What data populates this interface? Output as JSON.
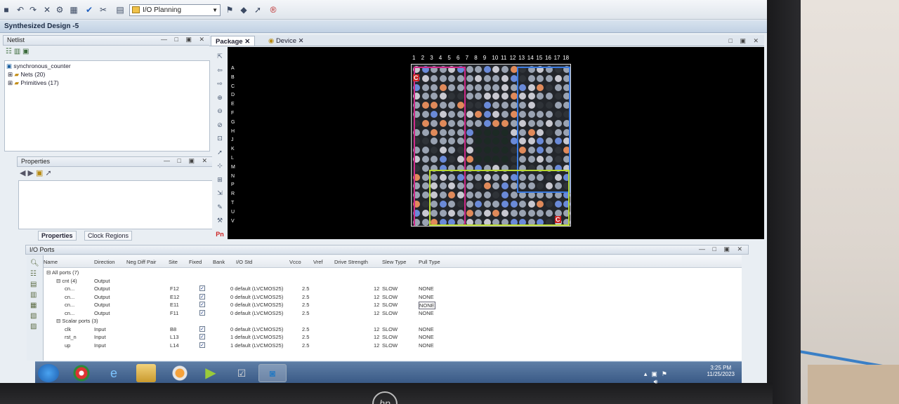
{
  "toolbar": {
    "layout_value": "I/O Planning"
  },
  "design_bar": {
    "title": "Synthesized Design -5"
  },
  "netlist": {
    "title": "Netlist",
    "root": "synchronous_counter",
    "nets": "Nets (20)",
    "primitives": "Primitives (17)"
  },
  "properties": {
    "title": "Properties",
    "tab_properties": "Properties",
    "tab_clock_regions": "Clock Regions"
  },
  "package_view": {
    "tab_package": "Package",
    "tab_device": "Device",
    "columns": [
      "1",
      "2",
      "3",
      "4",
      "5",
      "6",
      "7",
      "8",
      "9",
      "10",
      "11",
      "12",
      "13",
      "14",
      "15",
      "16",
      "17",
      "18"
    ],
    "rows": [
      "A",
      "B",
      "C",
      "D",
      "E",
      "F",
      "G",
      "H",
      "J",
      "K",
      "L",
      "M",
      "N",
      "P",
      "R",
      "T",
      "U",
      "V"
    ],
    "corner_labels": [
      "C",
      "C"
    ],
    "tool_pn": "Pn"
  },
  "io_ports": {
    "title": "I/O Ports",
    "headers": [
      "Name",
      "Direction",
      "Neg Diff Pair",
      "Site",
      "Fixed",
      "Bank",
      "I/O Std",
      "Vcco",
      "Vref",
      "Drive Strength",
      "Slew Type",
      "Pull Type"
    ],
    "rows": [
      {
        "name": "All ports (7)",
        "dir": "",
        "site": "",
        "fixed": false,
        "std": "",
        "vcco": "",
        "drive": "",
        "slew": "",
        "pull": ""
      },
      {
        "name": "cnt (4)",
        "dir": "Output",
        "site": "",
        "fixed": false,
        "std": "",
        "vcco": "",
        "drive": "",
        "slew": "",
        "pull": ""
      },
      {
        "name": "cn...",
        "dir": "Output",
        "site": "F12",
        "fixed": true,
        "std": "0  default (LVCMOS25)",
        "vcco": "2.5",
        "drive": "12",
        "slew": "SLOW",
        "pull": "NONE"
      },
      {
        "name": "cn...",
        "dir": "Output",
        "site": "E12",
        "fixed": true,
        "std": "0  default (LVCMOS25)",
        "vcco": "2.5",
        "drive": "12",
        "slew": "SLOW",
        "pull": "NONE"
      },
      {
        "name": "cn...",
        "dir": "Output",
        "site": "E11",
        "fixed": true,
        "std": "0  default (LVCMOS25)",
        "vcco": "2.5",
        "drive": "12",
        "slew": "SLOW",
        "pull": "NONE"
      },
      {
        "name": "cn...",
        "dir": "Output",
        "site": "F11",
        "fixed": true,
        "std": "0  default (LVCMOS25)",
        "vcco": "2.5",
        "drive": "12",
        "slew": "SLOW",
        "pull": "NONE"
      },
      {
        "name": "Scalar ports (3)",
        "dir": "",
        "site": "",
        "fixed": false,
        "std": "",
        "vcco": "",
        "drive": "",
        "slew": "",
        "pull": ""
      },
      {
        "name": "clk",
        "dir": "Input",
        "site": "B8",
        "fixed": true,
        "std": "0  default (LVCMOS25)",
        "vcco": "2.5",
        "drive": "12",
        "slew": "SLOW",
        "pull": "NONE"
      },
      {
        "name": "rst_n",
        "dir": "Input",
        "site": "L13",
        "fixed": true,
        "std": "1  default (LVCMOS25)",
        "vcco": "2.5",
        "drive": "12",
        "slew": "SLOW",
        "pull": "NONE"
      },
      {
        "name": "up",
        "dir": "Input",
        "site": "L14",
        "fixed": true,
        "std": "1  default (LVCMOS25)",
        "vcco": "2.5",
        "drive": "12",
        "slew": "SLOW",
        "pull": "NONE"
      }
    ]
  },
  "taskbar": {
    "time": "3:25 PM",
    "date": "11/25/2023"
  },
  "monitor": {
    "brand": "hp"
  }
}
